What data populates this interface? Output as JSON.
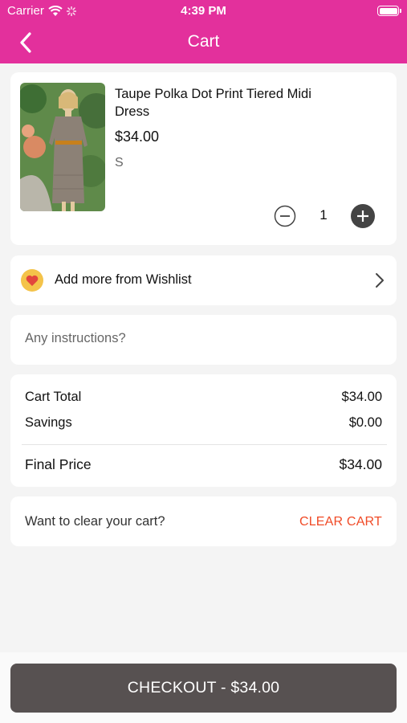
{
  "status_bar": {
    "carrier": "Carrier",
    "time": "4:39 PM"
  },
  "nav": {
    "title": "Cart",
    "back_icon": "chevron-left-icon"
  },
  "cart_item": {
    "name": "Taupe Polka Dot Print Tiered Midi Dress",
    "price": "$34.00",
    "size": "S",
    "quantity": "1"
  },
  "wishlist": {
    "label": "Add more from Wishlist",
    "icon": "heart-icon"
  },
  "instructions": {
    "placeholder": "Any instructions?"
  },
  "totals": {
    "cart_total_label": "Cart Total",
    "cart_total_value": "$34.00",
    "savings_label": "Savings",
    "savings_value": "$0.00",
    "final_label": "Final Price",
    "final_value": "$34.00"
  },
  "clear": {
    "prompt": "Want to clear your cart?",
    "button": "CLEAR CART"
  },
  "checkout": {
    "label": "CHECKOUT - $34.00"
  },
  "colors": {
    "brand": "#e3309c",
    "checkout_bg": "#575151",
    "clear_text": "#f04a26"
  }
}
